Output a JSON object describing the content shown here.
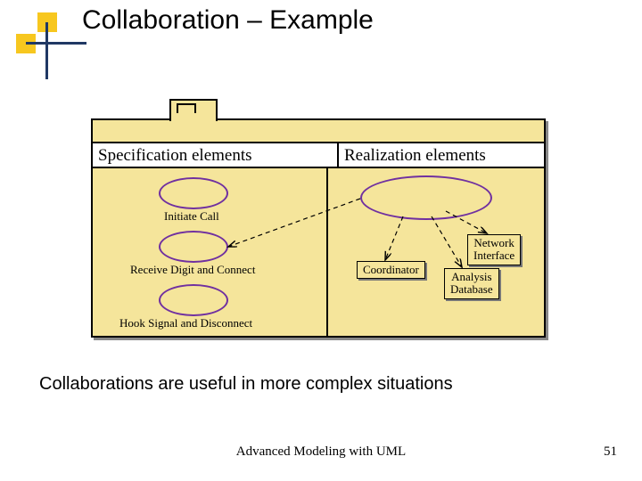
{
  "title": "Collaboration – Example",
  "header": {
    "left": "Specification elements",
    "right": "Realization elements"
  },
  "usecases": {
    "uc1": "Initiate Call",
    "uc2": "Receive Digit and Connect",
    "uc3": "Hook Signal and Disconnect"
  },
  "nodes": {
    "coordinator": "Coordinator",
    "network_if": "Network\nInterface",
    "analysis_db": "Analysis\nDatabase"
  },
  "note": "Collaborations are useful in more complex situations",
  "footer": "Advanced Modeling with UML",
  "page": "51"
}
